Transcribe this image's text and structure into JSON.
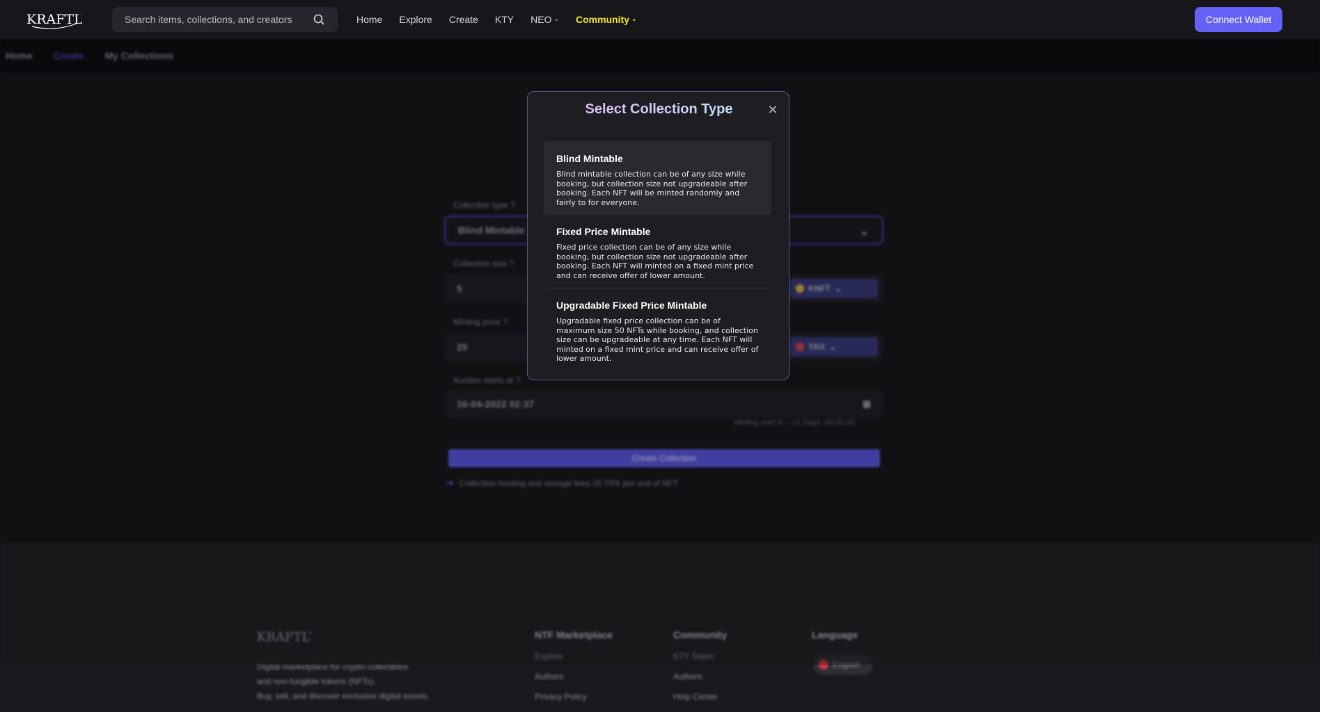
{
  "header": {
    "logo_text": "KRAFTLY",
    "search_placeholder": "Search items, collections, and creators",
    "nav": [
      {
        "label": "Home"
      },
      {
        "label": "Explore"
      },
      {
        "label": "Create"
      },
      {
        "label": "KTY"
      },
      {
        "label": "NEO",
        "dropdown": true
      },
      {
        "label": "Community",
        "dropdown": true,
        "highlight": "#f5e52a"
      }
    ],
    "connect_label": "Connect Wallet",
    "accent": "#6461f6"
  },
  "subnav": {
    "items": [
      "Home",
      "Create",
      "My Collections"
    ],
    "active": "Create"
  },
  "form": {
    "collection_type_label": "Collection type",
    "collection_type_value": "Blind Mintable",
    "collection_size_label": "Collection size",
    "collection_size_value": "5",
    "size_token": "KNFT",
    "minting_price_label": "Minting price",
    "minting_price_value": "25",
    "price_token": "TRX",
    "auction_label": "Auction starts at",
    "auction_value": "16-04-2022 02:37",
    "minting_hint": "Minting start in :- 01 Days :00:00:00",
    "create_button": "Create Collection",
    "fee_note": "Collection hosting and storage fees 25 TRX per unit of NFT"
  },
  "footer": {
    "logo_text": "KRAFTLY",
    "desc": [
      "Digital marketplace for crypto collectibles",
      "and non-fungible tokens (NFTs).",
      "Buy, sell, and discover exclusive digital assets."
    ],
    "col1": {
      "title": "NTF Marketplace",
      "links": [
        "Explore",
        "Authors",
        "Privacy Policy"
      ]
    },
    "col2": {
      "title": "Community",
      "links": [
        "KTY Token",
        "Authors",
        "Help Center"
      ]
    },
    "col3": {
      "title": "Language",
      "lang": "English"
    }
  },
  "modal": {
    "title": "Select Collection Type",
    "options": [
      {
        "title": "Blind Mintable",
        "desc": "Blind mintable collection can be of any size while booking, but collection size not upgradeable after booking. Each NFT will be minted randomly and fairly to for everyone."
      },
      {
        "title": "Fixed Price Mintable",
        "desc": "Fixed price collection can be of any size while booking, but collection size not upgradeable after booking. Each NFT will minted on a fixed mint price and can receive offer of lower amount."
      },
      {
        "title": "Upgradable Fixed Price Mintable",
        "desc": "Upgradable fixed price collection can be of maximum size 50 NFTs while booking, and collection size can be upgradeable at any time. Each NFT will minted on a fixed mint price and can receive offer of lower amount."
      }
    ]
  }
}
